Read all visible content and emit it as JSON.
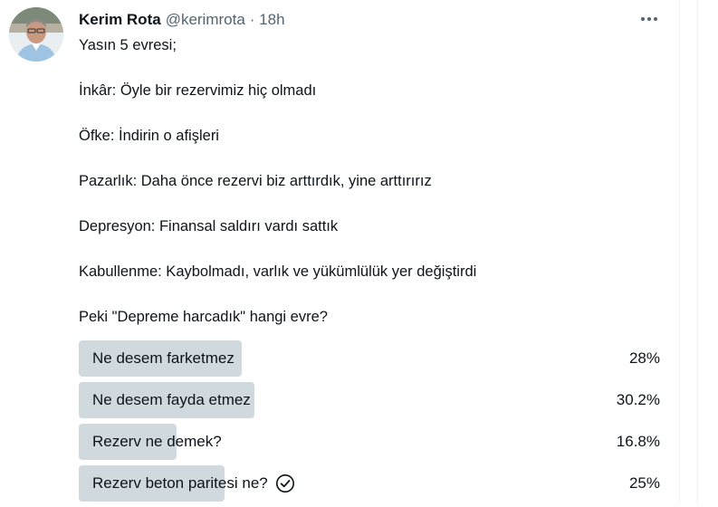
{
  "tweet": {
    "author_name": "Kerim Rota",
    "author_handle": "@kerimrota",
    "time": "· 18h",
    "lines": [
      "Yasın 5 evresi;",
      "İnkâr: Öyle bir rezervimiz hiç olmadı",
      "Öfke: İndirin o afişleri",
      "Pazarlık: Daha önce rezervi biz arttırdık, yine arttırırız",
      "Depresyon: Finansal saldırı vardı sattık",
      "Kabullenme: Kaybolmadı, varlık ve yükümlülük yer değiştirdi",
      "Peki \"Depreme harcadık\" hangi evre?"
    ]
  },
  "poll": {
    "bar_color": "#cfd9de",
    "options": [
      {
        "label": "Ne desem farketmez",
        "percent": "28%",
        "fraction": 0.28
      },
      {
        "label": "Ne desem fayda etmez",
        "percent": "30.2%",
        "fraction": 0.302
      },
      {
        "label": "Rezerv ne demek?",
        "percent": "16.8%",
        "fraction": 0.168
      },
      {
        "label": "Rezerv beton paritesi ne?",
        "percent": "25%",
        "fraction": 0.25,
        "selected_icon": "check-circle-icon"
      }
    ]
  },
  "icons": {
    "more": "more-horizontal-icon",
    "avatar": "avatar"
  }
}
